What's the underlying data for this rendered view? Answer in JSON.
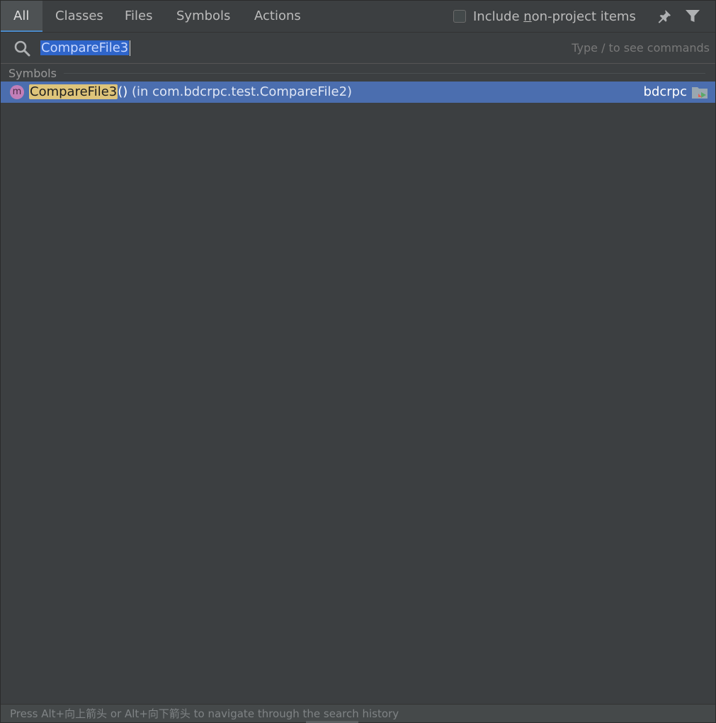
{
  "tabs": [
    {
      "label": "All",
      "active": true
    },
    {
      "label": "Classes",
      "active": false
    },
    {
      "label": "Files",
      "active": false
    },
    {
      "label": "Symbols",
      "active": false
    },
    {
      "label": "Actions",
      "active": false
    }
  ],
  "options": {
    "include_label_prefix": "Include ",
    "include_label_mnemonic": "n",
    "include_label_rest": "on-project items",
    "include_checked": false,
    "pin_icon": "pin-icon",
    "filter_icon": "filter-icon"
  },
  "search": {
    "icon": "search-icon",
    "query": "CompareFile3",
    "hint": "Type / to see commands"
  },
  "groups": [
    {
      "title": "Symbols",
      "items": [
        {
          "kind_icon": "method-icon",
          "kind_letter": "m",
          "match": "CompareFile3",
          "rest": "()",
          "location": " (in com.bdcrpc.test.CompareFile2)",
          "module": "bdcrpc",
          "module_icon": "module-folder-icon",
          "selected": true
        }
      ]
    }
  ],
  "footer": {
    "text": "Press Alt+向上箭头 or Alt+向下箭头 to navigate through the search history"
  },
  "colors": {
    "background": "#3c3f41",
    "selection": "#4b6eaf",
    "match_highlight": "#dec47a",
    "method_icon": "#c27fb8"
  }
}
